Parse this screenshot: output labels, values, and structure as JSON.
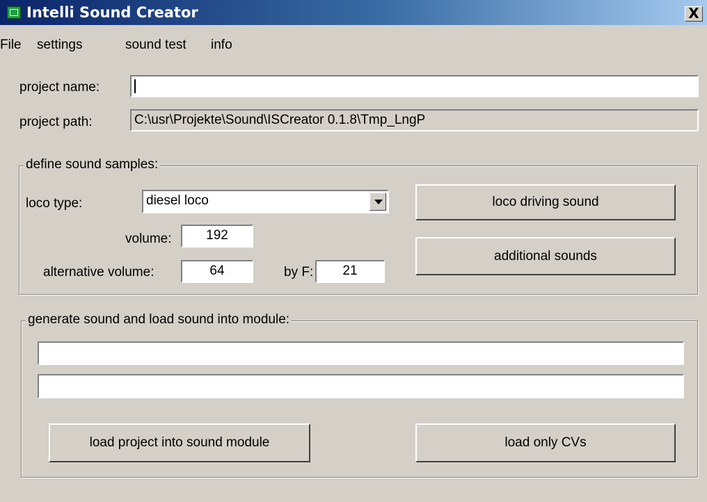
{
  "window": {
    "title": "Intelli Sound Creator",
    "close_label": "X"
  },
  "menu": [
    "File",
    "settings",
    "sound test",
    "info"
  ],
  "project": {
    "name_label": "project name:",
    "name_value": "",
    "path_label": "project path:",
    "path_value": "C:\\usr\\Projekte\\Sound\\ISCreator 0.1.8\\Tmp_LngP"
  },
  "samples": {
    "group_caption": "define sound samples:",
    "loco_type_label": "loco type:",
    "loco_type_value": "diesel loco",
    "volume_label": "volume:",
    "volume_value": "192",
    "alt_volume_label": "alternative volume:",
    "alt_volume_value": "64",
    "by_f_label": "by F:",
    "by_f_value": "21",
    "driving_button": "loco driving sound",
    "additional_button": "additional sounds"
  },
  "generate": {
    "group_caption": "generate sound and load sound into module:",
    "status_line_1": "",
    "status_line_2": "",
    "load_project_button": "load project into sound module",
    "load_cvs_button": "load only CVs"
  }
}
